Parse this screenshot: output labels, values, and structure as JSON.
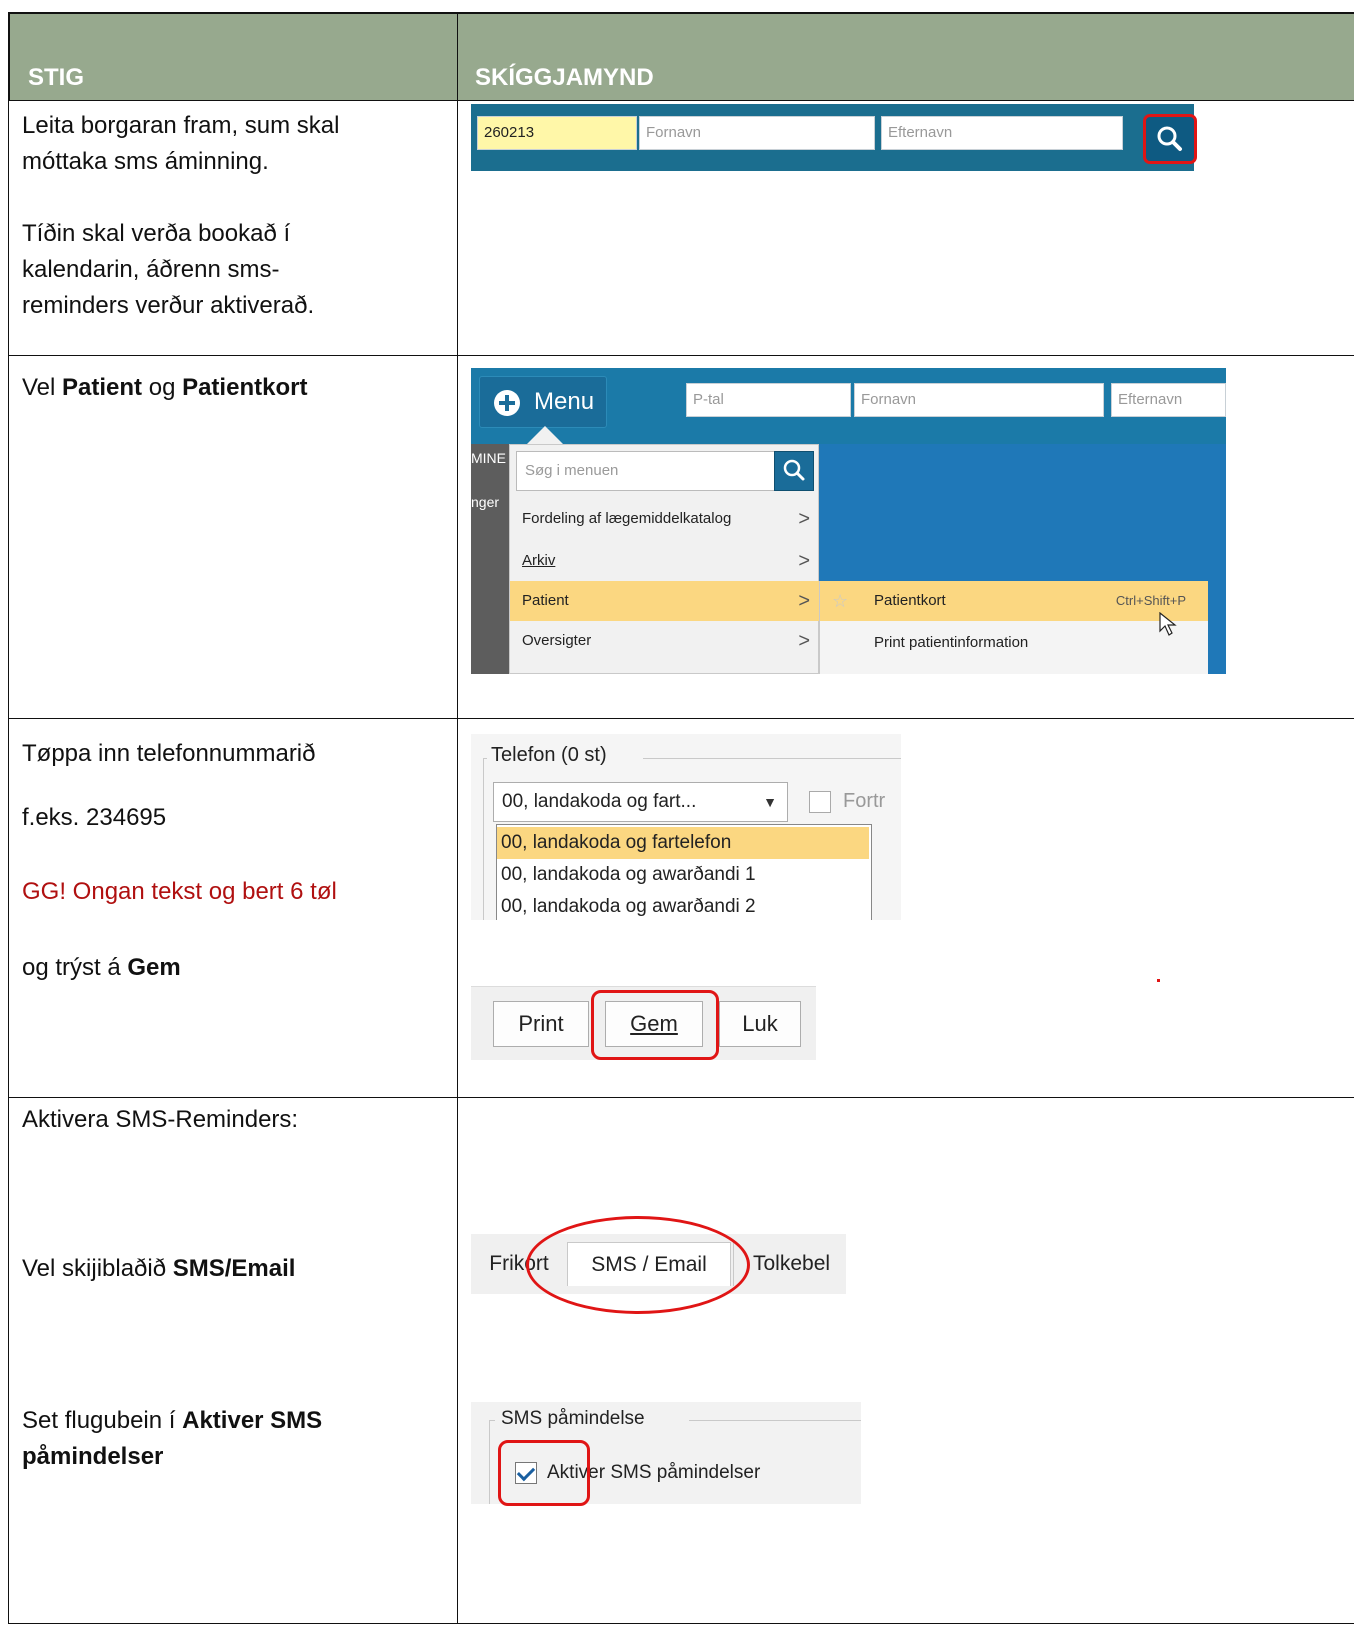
{
  "header": {
    "col1": "STIG",
    "col2": "SKÍGGJAMYND"
  },
  "rows": [
    {
      "step": {
        "line1": "Leita borgaran fram, sum skal",
        "line2": "móttaka sms áminning.",
        "line3": "Tíðin skal verða bookað í",
        "line4": "kalendarin, áðrenn sms-",
        "line5": "reminders verður aktiverað."
      },
      "screen": {
        "cpr_value": "260213",
        "fornavn_placeholder": "Fornavn",
        "efternavn_placeholder": "Efternavn"
      }
    },
    {
      "step": {
        "prefix": "Vel ",
        "bold1": "Patient",
        "mid": " og ",
        "bold2": "Patientkort"
      },
      "screen": {
        "menu_label": "Menu",
        "ptal_placeholder": "P-tal",
        "fornavn_placeholder": "Fornavn",
        "efternavn_placeholder": "Efternavn",
        "strip_text1": "MINE",
        "strip_text2": "nger",
        "search_placeholder": "Søg i menuen",
        "items": [
          "Fordeling af lægemiddelkatalog",
          "Arkiv",
          "Patient",
          "Oversigter"
        ],
        "sub_items": [
          "Patientkort",
          "Print patientinformation"
        ],
        "shortcut": "Ctrl+Shift+P"
      }
    },
    {
      "step": {
        "line1": "Tøppa inn telefonnummarið",
        "line2": "f.eks. 234695",
        "warning": "GG! Ongan tekst og bert 6 tøl",
        "line4_prefix": "og trýst á ",
        "line4_bold": "Gem"
      },
      "screen": {
        "group_label": "Telefon (0 st)",
        "combo_value": "00, landakoda og fart...",
        "checkbox_label": "Fortr",
        "options": [
          "00, landakoda og fartelefon",
          "00, landakoda og awarðandi 1",
          "00, landakoda og awarðandi 2"
        ],
        "buttons": [
          "Print",
          "Gem",
          "Luk"
        ]
      }
    },
    {
      "step": {
        "line1": "Aktivera SMS-Reminders:",
        "line2_prefix": "Vel skijiblaðið ",
        "line2_bold": "SMS/Email",
        "line3_prefix": "Set flugubein í ",
        "line3_bold": "Aktiver SMS",
        "line4_bold": "påmindelser"
      },
      "screen": {
        "tabs": [
          "Frikort",
          "SMS / Email",
          "Tolkebel"
        ],
        "group_label": "SMS påmindelse",
        "checkbox_label": "Aktiver SMS påmindelser"
      }
    }
  ],
  "colors": {
    "header_bg": "#97a98e",
    "highlight_red": "#e01515",
    "warning_text": "#b01010",
    "menu_blue": "#1b7aa8",
    "selected_item": "#fbd781"
  },
  "icons": [
    "search-icon",
    "plus-icon",
    "chevron-right-icon",
    "star-icon",
    "dropdown-arrow-icon",
    "checkbox-checked-icon",
    "mouse-cursor-icon"
  ]
}
